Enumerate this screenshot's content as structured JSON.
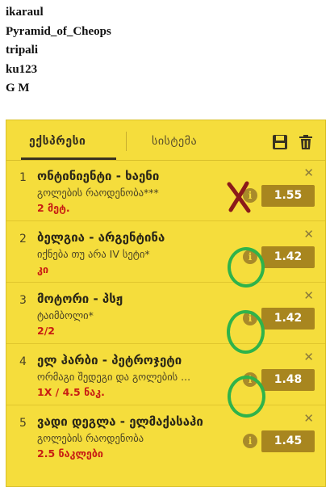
{
  "usernames": [
    "ikaraul",
    "Pyramid_of_Cheops",
    "tripali",
    "ku123",
    "G M"
  ],
  "betslip": {
    "tabs": {
      "express": "ექსპრესი",
      "system": "სისტემა"
    },
    "icons": {
      "save": "save-icon",
      "trash": "trash-icon",
      "info": "info-icon",
      "close": "close-icon"
    },
    "colors": {
      "panel": "#f5dd3c",
      "odds_bg": "#a8861f",
      "pick": "#c81d13",
      "ring": "#2fb34a",
      "cross": "#8b1a1a"
    },
    "bets": [
      {
        "num": "1",
        "match": "ონტინიენტი - ხაენი",
        "market": "გოლების რაოდენობა***",
        "pick": "2 მეტ.",
        "odds": "1.55"
      },
      {
        "num": "2",
        "match": "ბელგია - არგენტინა",
        "market": "იქნება თუ არა IV სეტი*",
        "pick": "კი",
        "odds": "1.42"
      },
      {
        "num": "3",
        "match": "მოტორი - პსჟ",
        "market": "ტაიმბოლი*",
        "pick": "2/2",
        "odds": "1.42"
      },
      {
        "num": "4",
        "match": "ელ ჰარბი - პეტროჯეტი",
        "market": "ორმაგი შედეგი და გოლების ...",
        "pick": "1X / 4.5 ნაკ.",
        "odds": "1.48"
      },
      {
        "num": "5",
        "match": "ვადი დეგლა - ელმაქასაჰი",
        "market": "გოლების რაოდენობა",
        "pick": "2.5 ნაკლები",
        "odds": "1.45"
      }
    ]
  }
}
